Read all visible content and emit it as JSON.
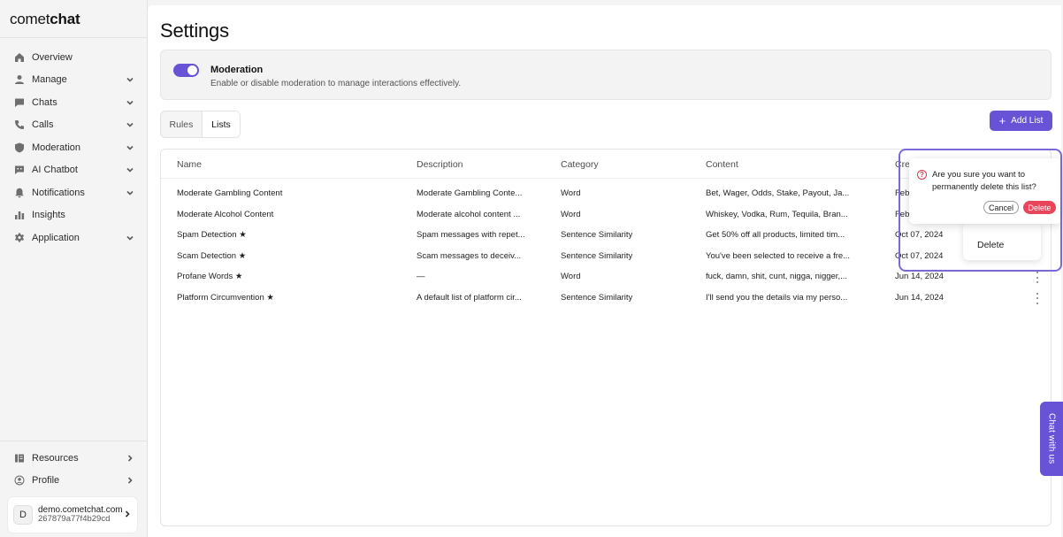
{
  "brand": {
    "logo_light": "comet",
    "logo_bold": "chat"
  },
  "sidebar": {
    "items": [
      {
        "label": "Overview",
        "icon": "home-icon",
        "has_chevron": false
      },
      {
        "label": "Manage",
        "icon": "user-icon",
        "has_chevron": true
      },
      {
        "label": "Chats",
        "icon": "chat-icon",
        "has_chevron": true
      },
      {
        "label": "Calls",
        "icon": "phone-icon",
        "has_chevron": true
      },
      {
        "label": "Moderation",
        "icon": "shield-icon",
        "has_chevron": true
      },
      {
        "label": "AI Chatbot",
        "icon": "bot-icon",
        "has_chevron": true
      },
      {
        "label": "Notifications",
        "icon": "bell-icon",
        "has_chevron": true
      },
      {
        "label": "Insights",
        "icon": "bar-chart-icon",
        "has_chevron": false
      },
      {
        "label": "Application",
        "icon": "gear-icon",
        "has_chevron": true
      }
    ],
    "bottom_items": [
      {
        "label": "Resources",
        "icon": "book-icon"
      },
      {
        "label": "Profile",
        "icon": "profile-icon"
      }
    ],
    "account": {
      "avatar_letter": "D",
      "name": "demo.cometchat.com",
      "id": "267879a77f4b29cd"
    }
  },
  "page": {
    "title": "Settings"
  },
  "moderation": {
    "title": "Moderation",
    "description": "Enable or disable moderation to manage interactions effectively.",
    "enabled": true
  },
  "tabs": {
    "rules": "Rules",
    "lists": "Lists",
    "active": "Lists"
  },
  "add_list": {
    "plus": "+",
    "label": "Add List"
  },
  "table": {
    "headers": {
      "name": "Name",
      "description": "Description",
      "category": "Category",
      "content": "Content",
      "created": "Crea"
    },
    "rows": [
      {
        "name": "Moderate Gambling Content",
        "description": "Moderate Gambling Conte...",
        "category": "Word",
        "content": "Bet, Wager, Odds, Stake, Payout, Ja...",
        "created": "Feb"
      },
      {
        "name": "Moderate Alcohol Content",
        "description": "Moderate alcohol content ...",
        "category": "Word",
        "content": "Whiskey, Vodka, Rum, Tequila, Bran...",
        "created": "Feb"
      },
      {
        "name": "Spam Detection ★",
        "description": "Spam messages with repet...",
        "category": "Sentence Similarity",
        "content": "Get 50% off all products, limited tim...",
        "created": "Oct 07, 2024"
      },
      {
        "name": "Scam Detection ★",
        "description": "Scam messages to deceiv...",
        "category": "Sentence Similarity",
        "content": "You've been selected to receive a fre...",
        "created": "Oct 07, 2024"
      },
      {
        "name": "Profane Words ★",
        "description": "—",
        "category": "Word",
        "content": "fuck, damn, shit, cunt, nigga, nigger,...",
        "created": "Jun 14, 2024"
      },
      {
        "name": "Platform Circumvention ★",
        "description": "A default list of platform cir...",
        "category": "Sentence Similarity",
        "content": "I'll send you the details via my perso...",
        "created": "Jun 14, 2024"
      }
    ]
  },
  "row_menu": {
    "delete": "Delete"
  },
  "confirm_dialog": {
    "icon": "?",
    "message": "Are you sure you want to permanently delete this list?",
    "cancel": "Cancel",
    "delete": "Delete"
  },
  "chat_widget": {
    "label": "Chat with us"
  },
  "colors": {
    "accent": "#6852d6",
    "danger": "#e8455a"
  }
}
